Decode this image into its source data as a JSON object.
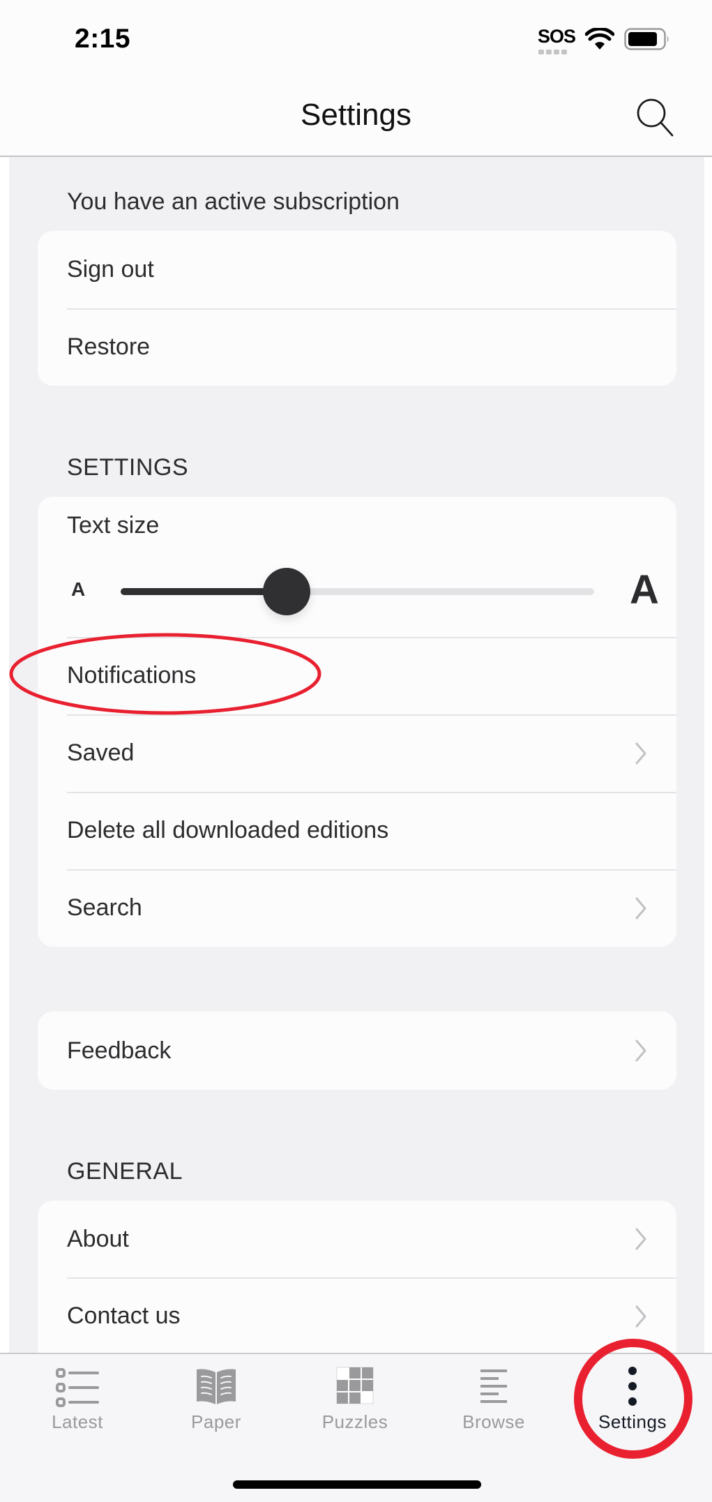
{
  "status_bar": {
    "time": "2:15",
    "carrier_text": "SOS",
    "wifi_icon": "wifi-icon",
    "battery_icon": "battery-icon"
  },
  "header": {
    "title": "Settings",
    "search_icon": "search-icon"
  },
  "subscription": {
    "heading": "You have an active subscription",
    "items": [
      {
        "label": "Sign out"
      },
      {
        "label": "Restore"
      }
    ]
  },
  "settings_section": {
    "heading": "SETTINGS",
    "text_size": {
      "label": "Text size",
      "small_glyph": "A",
      "large_glyph": "A",
      "value_fraction": 0.35
    },
    "items": [
      {
        "label": "Notifications",
        "chevron": false
      },
      {
        "label": "Saved",
        "chevron": true
      },
      {
        "label": "Delete all downloaded editions",
        "chevron": false
      },
      {
        "label": "Search",
        "chevron": true
      }
    ]
  },
  "feedback": {
    "label": "Feedback",
    "chevron": true
  },
  "general_section": {
    "heading": "GENERAL",
    "items": [
      {
        "label": "About",
        "chevron": true
      },
      {
        "label": "Contact us",
        "chevron": true
      }
    ]
  },
  "tab_bar": {
    "tabs": [
      {
        "label": "Latest",
        "icon": "list-icon",
        "active": false
      },
      {
        "label": "Paper",
        "icon": "open-book-icon",
        "active": false
      },
      {
        "label": "Puzzles",
        "icon": "crossword-grid-icon",
        "active": false
      },
      {
        "label": "Browse",
        "icon": "lines-icon",
        "active": false
      },
      {
        "label": "Settings",
        "icon": "vertical-dots-icon",
        "active": true
      }
    ]
  },
  "annotations": {
    "color": "#e8202f",
    "highlighted": [
      "Notifications",
      "Settings tab"
    ]
  }
}
